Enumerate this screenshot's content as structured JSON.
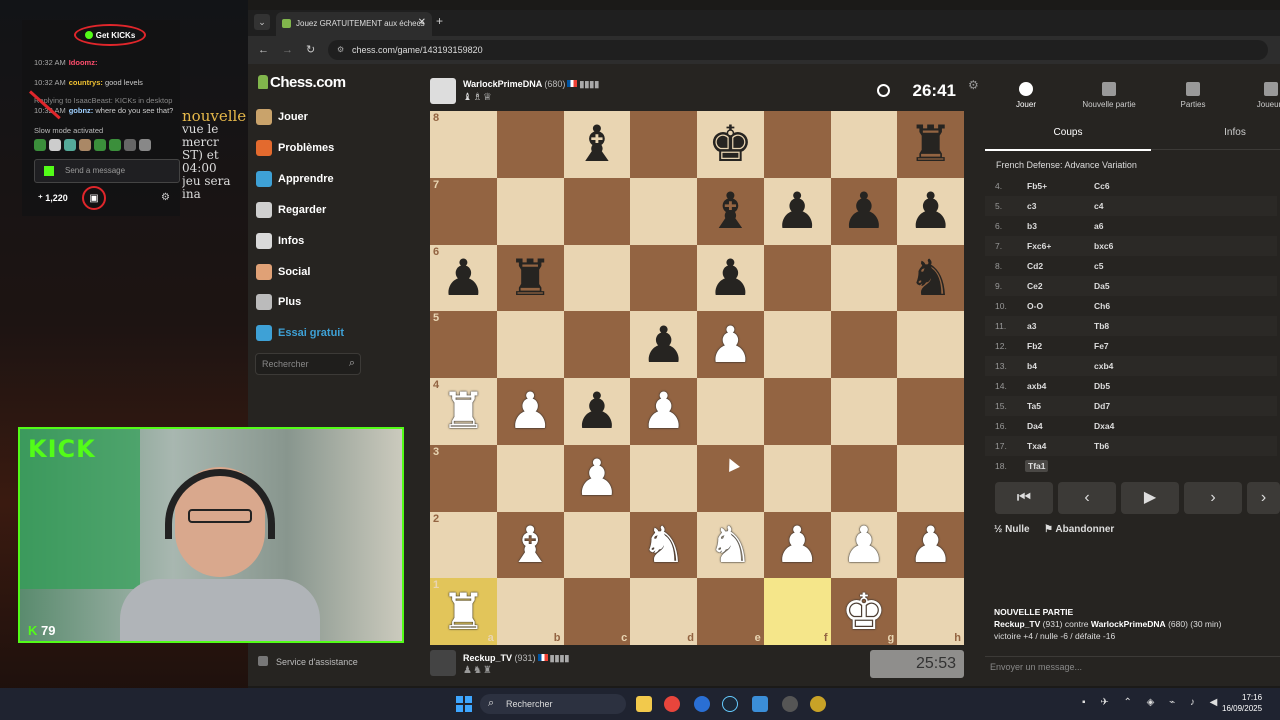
{
  "stream": {
    "get_kicks": "Get KICKs",
    "messages": [
      {
        "time": "10:32 AM",
        "user": "Idoomz:",
        "text": ""
      },
      {
        "time": "10:32 AM",
        "user": "countrys:",
        "text": "good levels"
      },
      {
        "time": "",
        "user": "",
        "text": "Replying to IsaacBeast: KICKs in desktop"
      },
      {
        "time": "10:32 AM",
        "user": "gobnz:",
        "text": "where do you see that?"
      }
    ],
    "slow_mode": "Slow mode activated",
    "input_placeholder": "Send a message",
    "points": "1,220",
    "overlay_lines": [
      "nouvelle",
      "vue le mercr",
      "ST) et 04:00",
      "jeu sera ina"
    ],
    "viewers": "79",
    "kick_logo": "KICK"
  },
  "browser": {
    "tab_title": "Jouez GRATUITEMENT aux échecs",
    "url": "chess.com/game/143193159820"
  },
  "sidebar": {
    "logo": "Chess.com",
    "items": [
      {
        "label": "Jouer",
        "color": "#c9a36b"
      },
      {
        "label": "Problèmes",
        "color": "#e36a2e"
      },
      {
        "label": "Apprendre",
        "color": "#3ea1d6"
      },
      {
        "label": "Regarder",
        "color": "#cfcfcf"
      },
      {
        "label": "Infos",
        "color": "#d9d9d9"
      },
      {
        "label": "Social",
        "color": "#e0a176"
      },
      {
        "label": "Plus",
        "color": "#bbbbbb"
      },
      {
        "label": "Essai gratuit",
        "color": "#3ea1d6"
      }
    ],
    "search_placeholder": "Rechercher",
    "support": "Service d'assistance"
  },
  "game": {
    "top_player": {
      "name": "WarlockPrimeDNA",
      "rating": "(680)",
      "captured": "♝♗♕"
    },
    "top_clock": "26:41",
    "bottom_player": {
      "name": "Reckup_TV",
      "rating": "(931)",
      "captured": "♟♞♜"
    },
    "bottom_clock": "25:53",
    "board": [
      [
        "",
        "",
        "b",
        "",
        "k",
        "",
        "",
        "r"
      ],
      [
        "",
        "",
        "",
        "",
        "b",
        "p",
        "p",
        "p"
      ],
      [
        "p",
        "r",
        "",
        "",
        "p",
        "",
        "",
        "n"
      ],
      [
        "",
        "",
        "",
        "p",
        "P",
        "",
        "",
        ""
      ],
      [
        "R",
        "P",
        "p",
        "P",
        "",
        "",
        "",
        ""
      ],
      [
        "",
        "",
        "P",
        "",
        "",
        "",
        "",
        ""
      ],
      [
        "",
        "B",
        "",
        "N",
        "N",
        "P",
        "P",
        "P"
      ],
      [
        "R",
        "",
        "",
        "",
        "",
        "",
        "K",
        ""
      ]
    ],
    "ranks": [
      "8",
      "7",
      "6",
      "5",
      "4",
      "3",
      "2",
      "1"
    ],
    "files": [
      "a",
      "b",
      "c",
      "d",
      "e",
      "f",
      "g",
      "h"
    ],
    "highlight": [
      "a1",
      "f1"
    ]
  },
  "panel": {
    "tabs": [
      "Jouer",
      "Nouvelle partie",
      "Parties",
      "Joueurs"
    ],
    "subtabs": [
      "Coups",
      "Infos"
    ],
    "opening": "French Defense: Advance Variation",
    "moves": [
      {
        "n": "4.",
        "w": "Fb5+",
        "b": "Cc6"
      },
      {
        "n": "5.",
        "w": "c3",
        "b": "c4"
      },
      {
        "n": "6.",
        "w": "b3",
        "b": "a6"
      },
      {
        "n": "7.",
        "w": "Fxc6+",
        "b": "bxc6"
      },
      {
        "n": "8.",
        "w": "Cd2",
        "b": "c5"
      },
      {
        "n": "9.",
        "w": "Ce2",
        "b": "Da5"
      },
      {
        "n": "10.",
        "w": "O-O",
        "b": "Ch6"
      },
      {
        "n": "11.",
        "w": "a3",
        "b": "Tb8"
      },
      {
        "n": "12.",
        "w": "Fb2",
        "b": "Fe7"
      },
      {
        "n": "13.",
        "w": "b4",
        "b": "cxb4"
      },
      {
        "n": "14.",
        "w": "axb4",
        "b": "Db5"
      },
      {
        "n": "15.",
        "w": "Ta5",
        "b": "Dd7"
      },
      {
        "n": "16.",
        "w": "Da4",
        "b": "Dxa4"
      },
      {
        "n": "17.",
        "w": "Txa4",
        "b": "Tb6"
      },
      {
        "n": "18.",
        "w": "Tfa1",
        "b": ""
      }
    ],
    "draw": "Nulle",
    "resign": "Abandonner",
    "newgame_title": "NOUVELLE PARTIE",
    "newgame_p1": "Reckup_TV",
    "newgame_r1": "(931)",
    "newgame_vs": "contre",
    "newgame_p2": "WarlockPrimeDNA",
    "newgame_r2": "(680) (30 min)",
    "newgame_stats": "victoire +4 / nulle -6 / défaite -16",
    "chat_placeholder": "Envoyer un message..."
  },
  "taskbar": {
    "search": "Rechercher",
    "time": "17:16",
    "date": "16/09/2025"
  }
}
